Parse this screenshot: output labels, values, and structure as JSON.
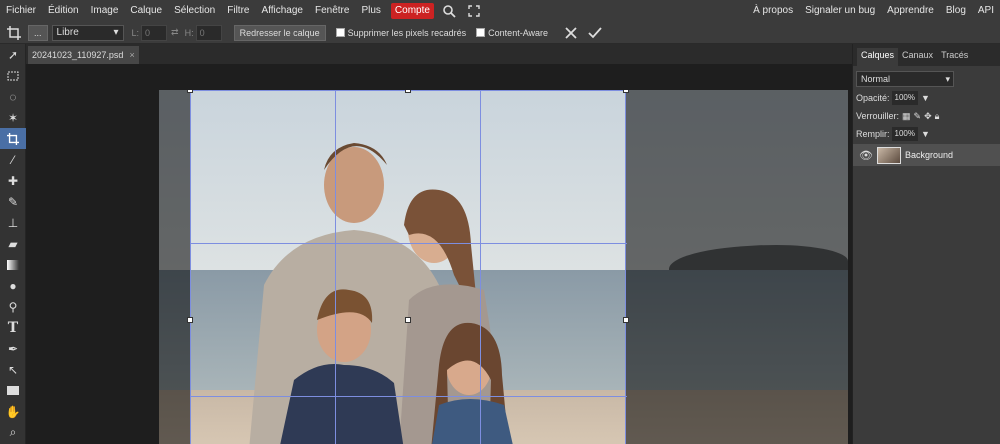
{
  "menu": {
    "items": [
      "Fichier",
      "Édition",
      "Image",
      "Calque",
      "Sélection",
      "Filtre",
      "Affichage",
      "Fenêtre",
      "Plus"
    ],
    "account": "Compte",
    "right_items": [
      "À propos",
      "Signaler un bug",
      "Apprendre",
      "Blog",
      "API"
    ]
  },
  "options": {
    "more_label": "...",
    "ratio_value": "Libre",
    "width_label": "L:",
    "width_value": "0",
    "height_label": "H:",
    "height_value": "0",
    "straighten_label": "Redresser le calque",
    "delete_pixels_label": "Supprimer les pixels recadrés",
    "content_aware_label": "Content-Aware"
  },
  "document": {
    "tab_title": "20241023_110927.psd",
    "close_glyph": "×"
  },
  "panel": {
    "tabs": [
      "Calques",
      "Canaux",
      "Tracés"
    ],
    "blend_mode": "Normal",
    "opacity_label": "Opacité:",
    "opacity_value": "100%",
    "lock_label": "Verrouiller:",
    "fill_label": "Remplir:",
    "fill_value": "100%",
    "layer_name": "Background"
  },
  "tools": [
    "move-tool",
    "marquee-tool",
    "lasso-tool",
    "magic-wand-tool",
    "crop-tool",
    "eyedropper-tool",
    "healing-tool",
    "brush-tool",
    "clone-stamp-tool",
    "eraser-tool",
    "gradient-tool",
    "blur-tool",
    "dodge-tool",
    "type-tool",
    "pen-tool",
    "path-select-tool",
    "shape-tool",
    "hand-tool",
    "zoom-tool"
  ],
  "colors": {
    "accent": "#cc2222",
    "crop_guide": "#7d8ee0",
    "active_tool": "#4a6fa5"
  }
}
